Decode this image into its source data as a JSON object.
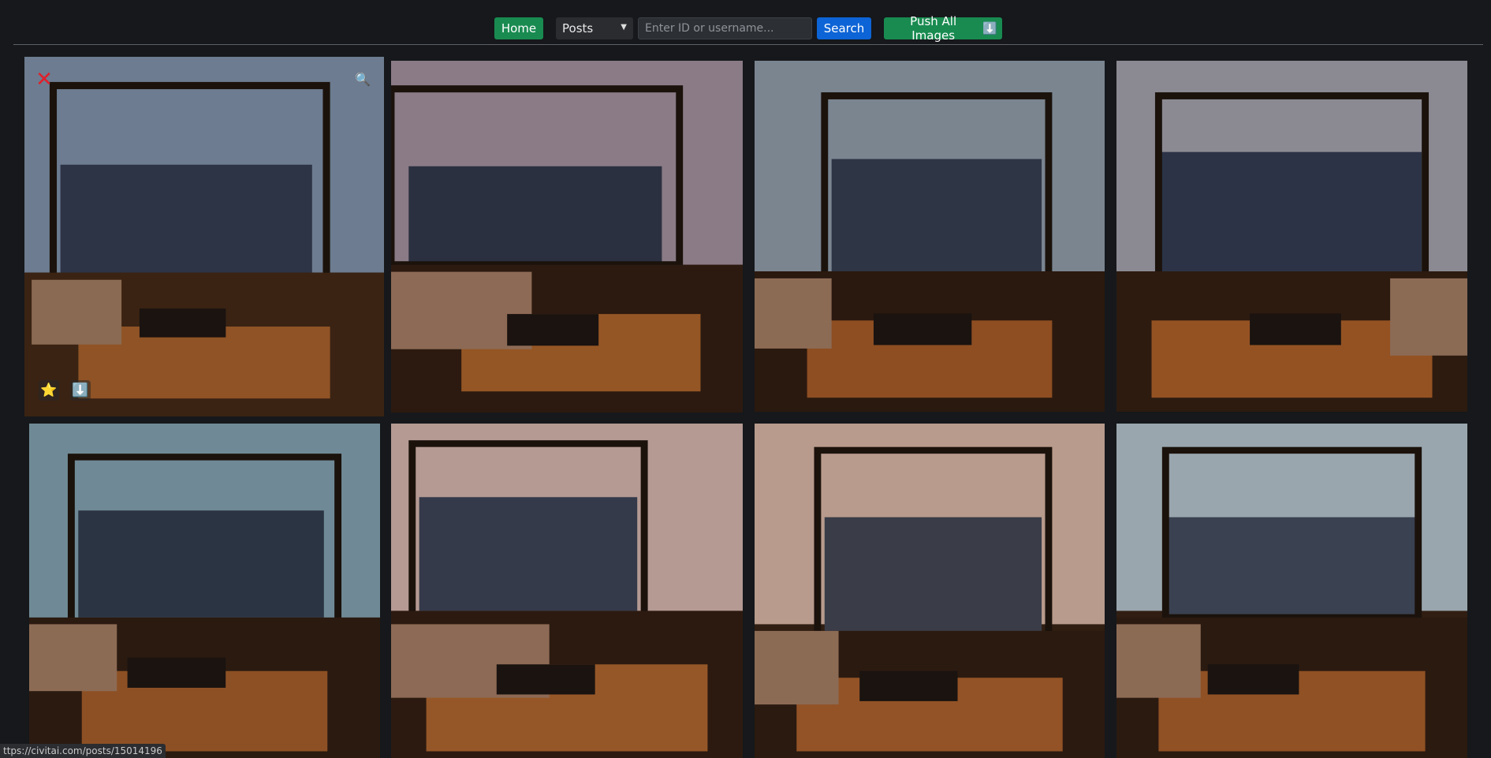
{
  "toolbar": {
    "home_label": "Home",
    "type_select": {
      "selected": "Posts"
    },
    "search_placeholder": "Enter ID or username...",
    "search_label": "Search",
    "push_label": "Push All Images",
    "push_icon": "⬇️"
  },
  "overlay": {
    "close_icon": "✕",
    "zoom_icon": "🔍",
    "favorite_icon": "⭐",
    "download_icon": "⬇️"
  },
  "gallery": {
    "images": [
      {
        "palette": [
          "#6d7c90",
          "#2d3446",
          "#b5682e",
          "#3a2313"
        ]
      },
      {
        "palette": [
          "#8a7b86",
          "#2b3040",
          "#c2702f",
          "#2c1a10"
        ]
      },
      {
        "palette": [
          "#7a8590",
          "#2e3545",
          "#b9652b",
          "#2a190f"
        ]
      },
      {
        "palette": [
          "#8b8a92",
          "#2c3346",
          "#c06a2c",
          "#2d1b10"
        ]
      },
      {
        "palette": [
          "#6f8a96",
          "#2b3442",
          "#b8682e",
          "#2b1a10"
        ]
      },
      {
        "palette": [
          "#b49a93",
          "#353a4a",
          "#c37233",
          "#2c1a10"
        ]
      },
      {
        "palette": [
          "#b89b8c",
          "#3a3d48",
          "#c06c30",
          "#2b1a10"
        ]
      },
      {
        "palette": [
          "#9aa6ae",
          "#3a4150",
          "#bc6a2e",
          "#2b1a10"
        ]
      }
    ]
  },
  "status_url": "ttps://civitai.com/posts/15014196"
}
